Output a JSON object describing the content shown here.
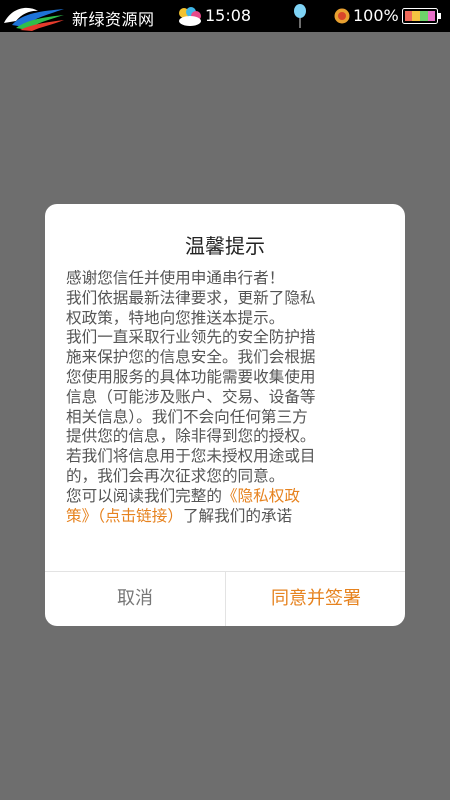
{
  "status_bar": {
    "app_name": "新绿资源网",
    "time": "15:08",
    "battery_percent": "100%",
    "icons": [
      "site-logo-icon",
      "weather-cloud-icon",
      "balloon-icon",
      "sun-icon",
      "battery-icon"
    ]
  },
  "dialog": {
    "title": "温馨提示",
    "lines": [
      "感谢您信任并使用申通串行者！",
      "我们依据最新法律要求，更新了隐私",
      "权政策，特地向您推送本提示。",
      "我们一直采取行业领先的安全防护措",
      "施来保护您的信息安全。我们会根据",
      "您使用服务的具体功能需要收集使用",
      "信息（可能涉及账户、交易、设备等",
      "相关信息）。我们不会向任何第三方",
      "提供您的信息，除非得到您的授权。",
      "若我们将信息用于您未授权用途或目",
      "的，我们会再次征求您的同意。"
    ],
    "policy_prefix": "您可以阅读我们完整的",
    "policy_link_part1": "《隐私权政",
    "policy_link_part2": "策》（点击链接）",
    "policy_suffix": "了解我们的承诺",
    "cancel_label": "取消",
    "agree_label": "同意并签署"
  },
  "colors": {
    "accent": "#e6821e",
    "overlay": "#6e6e6e",
    "status_bar": "#000000"
  }
}
